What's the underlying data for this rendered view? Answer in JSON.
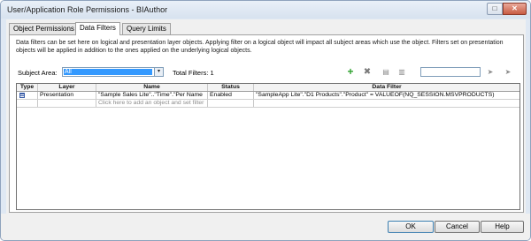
{
  "window": {
    "title": "User/Application Role Permissions - BIAuthor",
    "max_glyph": "□",
    "close_glyph": "✕"
  },
  "tabs": [
    {
      "label": "Object Permissions",
      "active": false
    },
    {
      "label": "Data Filters",
      "active": true
    },
    {
      "label": "Query Limits",
      "active": false
    }
  ],
  "description": "Data filters can be set here on logical and presentation layer objects. Applying filter on a logical object will impact all subject areas which use the object. Filters set on presentation objects will be applied in addition to the ones applied on the underlying logical objects.",
  "subject_area": {
    "label": "Subject Area:",
    "value": "All",
    "arrow": "▾"
  },
  "total_filters": "Total Filters: 1",
  "toolbar": {
    "add_icon": "+",
    "delete_icon": "✖",
    "edit_icon": "▤",
    "copy_icon": "▥",
    "find_icon": "➤",
    "find_next_icon": "➤",
    "search_value": ""
  },
  "grid": {
    "columns": [
      "Type",
      "Layer",
      "Name",
      "Status",
      "Data Filter"
    ],
    "rows": [
      {
        "layer": "Presentation",
        "name": "\"Sample Sales Lite\"..\"Time\".\"Per Name",
        "status": "Enabled",
        "filter": "\"SampleApp Lite\".\"D1 Products\".\"Product\" = VALUEOF(NQ_SESSION.MSVPRODUCTS)"
      }
    ],
    "add_hint": "Click here to add an object and set filter"
  },
  "buttons": {
    "ok": "OK",
    "cancel": "Cancel",
    "help": "Help"
  }
}
